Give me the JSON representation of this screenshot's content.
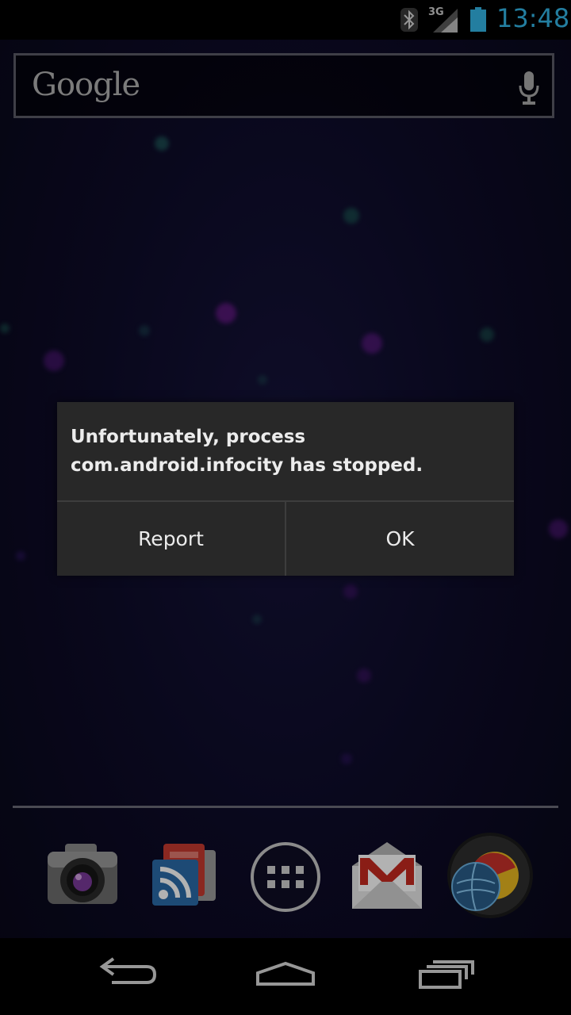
{
  "status_bar": {
    "clock": "13:48",
    "network_type": "3G",
    "icons": [
      "bluetooth-icon",
      "signal-icon",
      "battery-icon"
    ],
    "clock_color": "#33b5e5"
  },
  "search_bar": {
    "logo_text": "Google",
    "icons": [
      "mic-icon"
    ]
  },
  "dialog": {
    "message": "Unfortunately, process com.android.infocity has stopped.",
    "buttons": {
      "report": "Report",
      "ok": "OK"
    },
    "background_color": "#282828"
  },
  "dock": {
    "apps": [
      "camera-icon",
      "news-weather-icon",
      "app-drawer-icon",
      "gmail-icon",
      "browser-icon"
    ]
  },
  "nav_bar": {
    "buttons": [
      "back-icon",
      "home-icon",
      "recents-icon"
    ]
  }
}
